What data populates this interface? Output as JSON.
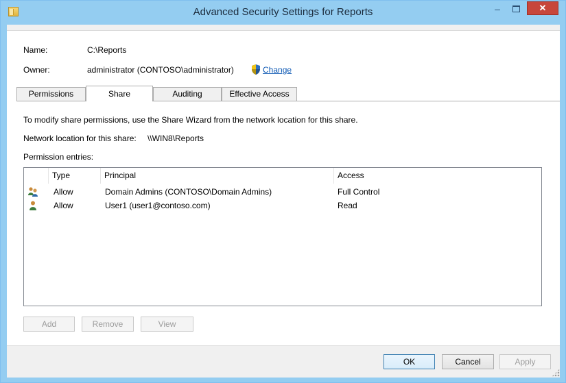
{
  "window": {
    "title": "Advanced Security Settings for Reports",
    "minimize_glyph": "–",
    "close_glyph": "✕"
  },
  "header": {
    "name_label": "Name:",
    "name_value": "C:\\Reports",
    "owner_label": "Owner:",
    "owner_value": "administrator (CONTOSO\\administrator)",
    "change_link": "Change"
  },
  "tabs": [
    {
      "label": "Permissions",
      "active": false
    },
    {
      "label": "Share",
      "active": true
    },
    {
      "label": "Auditing",
      "active": false
    },
    {
      "label": "Effective Access",
      "active": false
    }
  ],
  "share": {
    "instructions": "To modify share permissions, use the Share Wizard from the network location for this share.",
    "network_location_label": "Network location for this share:",
    "network_location_value": "\\\\WIN8\\Reports",
    "entries_label": "Permission entries:"
  },
  "table": {
    "columns": [
      "Type",
      "Principal",
      "Access"
    ],
    "rows": [
      {
        "icon": "group-users-icon",
        "type": "Allow",
        "principal": "Domain Admins (CONTOSO\\Domain Admins)",
        "access": "Full Control"
      },
      {
        "icon": "user-icon",
        "type": "Allow",
        "principal": "User1 (user1@contoso.com)",
        "access": "Read"
      }
    ]
  },
  "entry_buttons": {
    "add": "Add",
    "remove": "Remove",
    "view": "View"
  },
  "dialog_buttons": {
    "ok": "OK",
    "cancel": "Cancel",
    "apply": "Apply"
  },
  "colors": {
    "titlebar": "#94cdf1",
    "close_button": "#c7463b",
    "link": "#0b57b3"
  }
}
